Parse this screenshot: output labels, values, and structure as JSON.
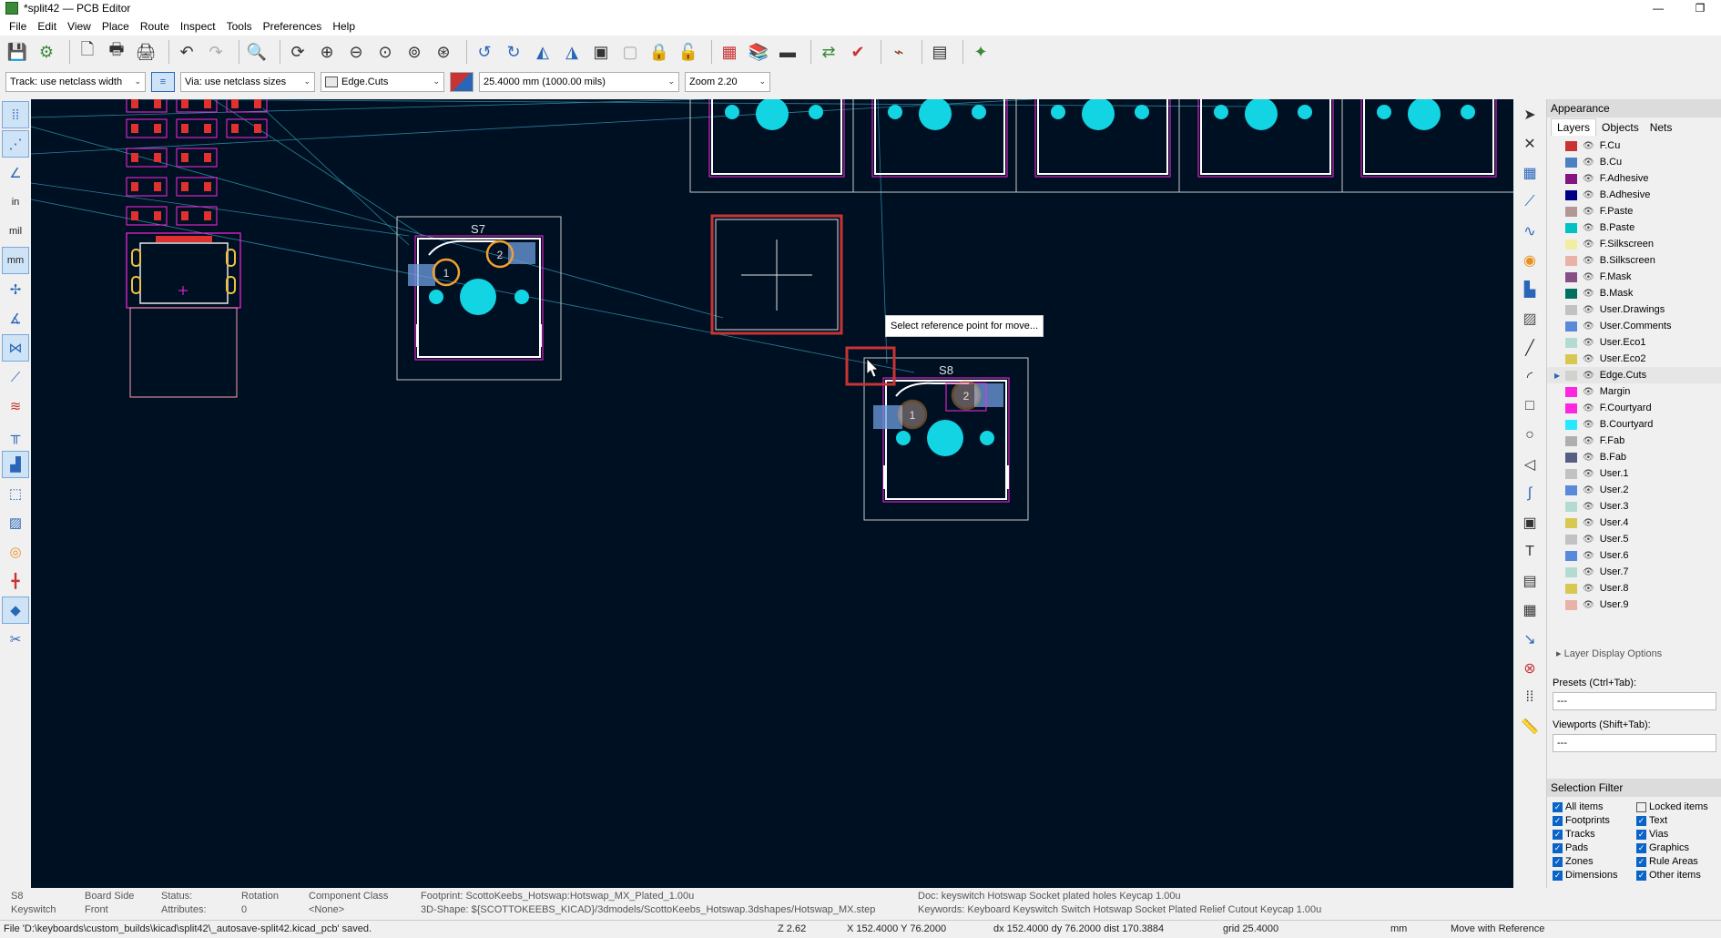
{
  "window": {
    "title": "*split42 — PCB Editor",
    "minimize": "—",
    "restore": "❐"
  },
  "menu": [
    "File",
    "Edit",
    "View",
    "Place",
    "Route",
    "Inspect",
    "Tools",
    "Preferences",
    "Help"
  ],
  "options": {
    "track": "Track: use netclass width",
    "via": "Via: use netclass sizes",
    "layer": "Edge.Cuts",
    "grid": "25.4000 mm (1000.00 mils)",
    "zoom": "Zoom 2.20"
  },
  "canvas": {
    "footprint_s7_ref": "S7",
    "footprint_s8_ref": "S8",
    "pad1": "1",
    "pad2": "2",
    "tooltip": "Select reference point for move..."
  },
  "appearance": {
    "title": "Appearance",
    "tabs": [
      "Layers",
      "Objects",
      "Nets"
    ],
    "layers": [
      {
        "name": "F.Cu",
        "color": "#c83434"
      },
      {
        "name": "B.Cu",
        "color": "#4d7fc4"
      },
      {
        "name": "F.Adhesive",
        "color": "#841384"
      },
      {
        "name": "B.Adhesive",
        "color": "#000084"
      },
      {
        "name": "F.Paste",
        "color": "#b49696"
      },
      {
        "name": "B.Paste",
        "color": "#00c2c2"
      },
      {
        "name": "F.Silkscreen",
        "color": "#f2eda1"
      },
      {
        "name": "B.Silkscreen",
        "color": "#e8b2a7"
      },
      {
        "name": "F.Mask",
        "color": "#845086"
      },
      {
        "name": "B.Mask",
        "color": "#027060"
      },
      {
        "name": "User.Drawings",
        "color": "#c2c2c2"
      },
      {
        "name": "User.Comments",
        "color": "#5989db"
      },
      {
        "name": "User.Eco1",
        "color": "#b4dbd2"
      },
      {
        "name": "User.Eco2",
        "color": "#d8c852"
      },
      {
        "name": "Edge.Cuts",
        "color": "#d0d2cd"
      },
      {
        "name": "Margin",
        "color": "#ff26e2"
      },
      {
        "name": "F.Courtyard",
        "color": "#ff26e2"
      },
      {
        "name": "B.Courtyard",
        "color": "#26e9ff"
      },
      {
        "name": "F.Fab",
        "color": "#afafaf"
      },
      {
        "name": "B.Fab",
        "color": "#585d84"
      },
      {
        "name": "User.1",
        "color": "#c2c2c2"
      },
      {
        "name": "User.2",
        "color": "#5989db"
      },
      {
        "name": "User.3",
        "color": "#b4dbd2"
      },
      {
        "name": "User.4",
        "color": "#d8c852"
      },
      {
        "name": "User.5",
        "color": "#c2c2c2"
      },
      {
        "name": "User.6",
        "color": "#5989db"
      },
      {
        "name": "User.7",
        "color": "#b4dbd2"
      },
      {
        "name": "User.8",
        "color": "#d8c852"
      },
      {
        "name": "User.9",
        "color": "#e8b2a7"
      }
    ],
    "layer_display_options": "Layer Display Options",
    "presets_label": "Presets (Ctrl+Tab):",
    "presets_value": "---",
    "viewports_label": "Viewports (Shift+Tab):",
    "viewports_value": "---"
  },
  "selection_filter": {
    "title": "Selection Filter",
    "items": [
      {
        "label": "All items",
        "checked": true
      },
      {
        "label": "Locked items",
        "checked": false
      },
      {
        "label": "Footprints",
        "checked": true
      },
      {
        "label": "Text",
        "checked": true
      },
      {
        "label": "Tracks",
        "checked": true
      },
      {
        "label": "Vias",
        "checked": true
      },
      {
        "label": "Pads",
        "checked": true
      },
      {
        "label": "Graphics",
        "checked": true
      },
      {
        "label": "Zones",
        "checked": true
      },
      {
        "label": "Rule Areas",
        "checked": true
      },
      {
        "label": "Dimensions",
        "checked": true
      },
      {
        "label": "Other items",
        "checked": true
      }
    ]
  },
  "msgpanel": {
    "ref": "S8",
    "ref_sub": "Keyswitch",
    "side_label": "Board Side",
    "side": "Front",
    "status_label": "Status:",
    "attrs_label": "Attributes:",
    "rotation_label": "Rotation",
    "rotation": "0",
    "class_label": "Component Class",
    "class": "<None>",
    "footprint": "Footprint: ScottoKeebs_Hotswap:Hotswap_MX_Plated_1.00u",
    "shape": "3D-Shape: ${SCOTTOKEEBS_KICAD}/3dmodels/ScottoKeebs_Hotswap.3dshapes/Hotswap_MX.step",
    "doc": "Doc: keyswitch Hotswap Socket plated holes Keycap 1.00u",
    "keywords": "Keywords: Keyboard Keyswitch Switch Hotswap Socket Plated Relief Cutout Keycap 1.00u"
  },
  "status": {
    "message": "File 'D:\\keyboards\\custom_builds\\kicad\\split42\\_autosave-split42.kicad_pcb' saved.",
    "z": "Z 2.62",
    "xy": "X 152.4000  Y 76.2000",
    "delta": "dx 152.4000  dy 76.2000  dist 170.3884",
    "grid": "grid 25.4000",
    "units": "mm",
    "mode": "Move with Reference"
  }
}
